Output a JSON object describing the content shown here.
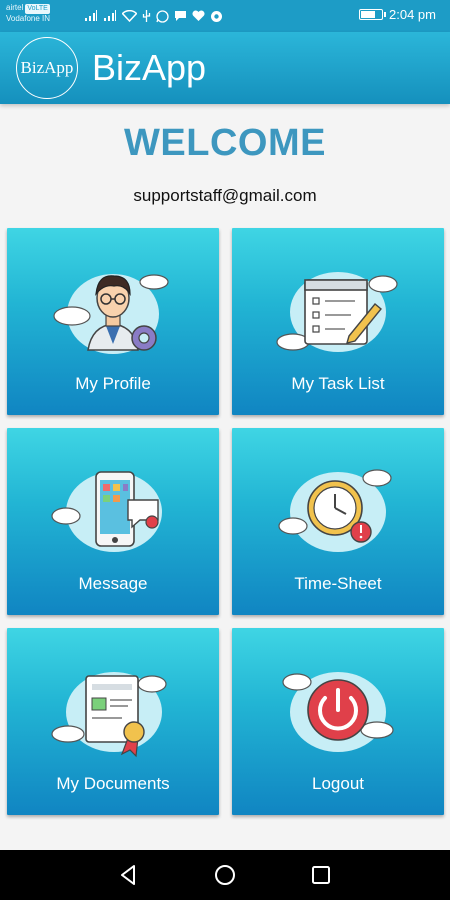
{
  "status_bar": {
    "carrier_line1": "airtel",
    "volte_badge": "VoLTE",
    "carrier_line2": "Vodafone IN",
    "time": "2:04 pm"
  },
  "app_bar": {
    "logo_text": "BizApp",
    "title": "BizApp"
  },
  "welcome": {
    "heading": "WELCOME",
    "email": "supportstaff@gmail.com"
  },
  "tiles": [
    {
      "label": "My Profile",
      "icon": "profile-icon"
    },
    {
      "label": "My Task List",
      "icon": "task-list-icon"
    },
    {
      "label": "Message",
      "icon": "message-icon"
    },
    {
      "label": "Time-Sheet",
      "icon": "clock-icon"
    },
    {
      "label": "My Documents",
      "icon": "documents-icon"
    },
    {
      "label": "Logout",
      "icon": "power-icon"
    }
  ],
  "colors": {
    "status_bar": "#1d9cc6",
    "app_bar": "#1a9fc8",
    "welcome_text": "#3d97bf",
    "tile_top": "#3fd5e4",
    "tile_bottom": "#1085c2"
  }
}
